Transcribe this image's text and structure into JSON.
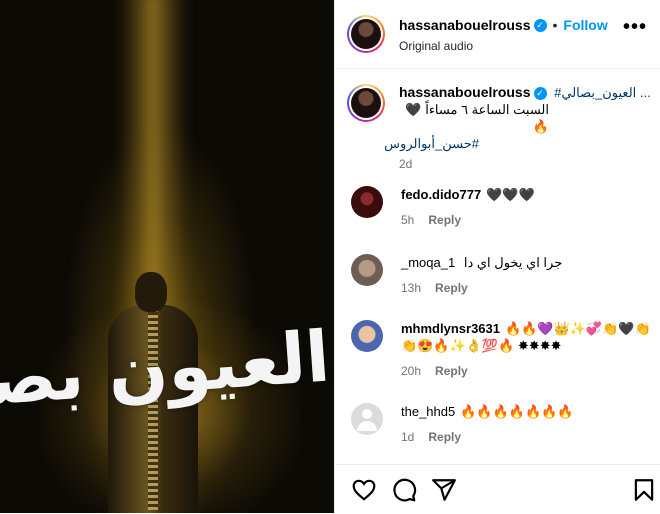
{
  "media": {
    "title_art": "العيون بصالي"
  },
  "header": {
    "username": "hassanabouelrouss",
    "verified": true,
    "separator": "•",
    "follow_label": "Follow",
    "audio_label": "Original audio",
    "more_icon": "more-horizontal-icon"
  },
  "caption": {
    "username": "hassanabouelrouss",
    "line1": "#العيون_بصالي ...",
    "line2": "السبت الساعة ٦ مساءاً 🖤🔥",
    "hashtag": "#حسن_أبوالروس",
    "time": "2d"
  },
  "comments": [
    {
      "username": "fedo.dido777",
      "text": "🖤🖤🖤",
      "time": "5h",
      "reply_label": "Reply"
    },
    {
      "username": "_moqa_1",
      "text": "جرا اي يخول اي دا",
      "time": "13h",
      "reply_label": "Reply"
    },
    {
      "username": "mhmdlynsr3631",
      "text": "🔥🔥💜👑✨💞👏🖤👏👏😍🔥✨👌💯🔥 ✸✸✸✸",
      "time": "20h",
      "reply_label": "Reply"
    },
    {
      "username": "the_hhd5",
      "text": "🔥🔥🔥🔥🔥🔥🔥",
      "time": "1d",
      "reply_label": "Reply"
    }
  ],
  "footer": {
    "icons": [
      "heart-icon",
      "comment-icon",
      "share-icon",
      "bookmark-icon"
    ]
  },
  "colors": {
    "accent": "#0095f6",
    "link": "#00376b",
    "muted": "#737373"
  }
}
